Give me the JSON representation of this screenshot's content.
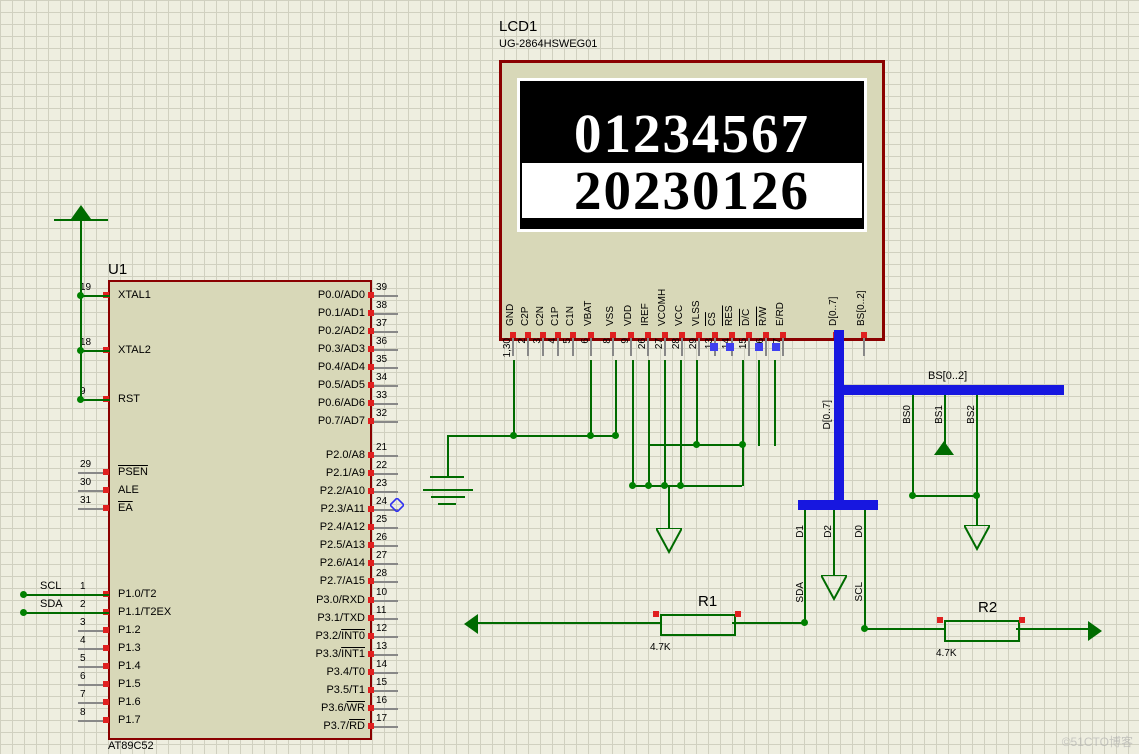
{
  "watermark": "©51CTO博客",
  "u1": {
    "name": "U1",
    "part": "AT89C52",
    "left_pins": [
      {
        "num": "19",
        "name": "XTAL1"
      },
      {
        "num": "18",
        "name": "XTAL2"
      },
      {
        "num": "9",
        "name": "RST"
      },
      {
        "num": "29",
        "name": "PSEN",
        "ov": true
      },
      {
        "num": "30",
        "name": "ALE"
      },
      {
        "num": "31",
        "name": "EA",
        "ov": true
      },
      {
        "num": "1",
        "name": "P1.0/T2"
      },
      {
        "num": "2",
        "name": "P1.1/T2EX"
      },
      {
        "num": "3",
        "name": "P1.2"
      },
      {
        "num": "4",
        "name": "P1.3"
      },
      {
        "num": "5",
        "name": "P1.4"
      },
      {
        "num": "6",
        "name": "P1.5"
      },
      {
        "num": "7",
        "name": "P1.6"
      },
      {
        "num": "8",
        "name": "P1.7"
      }
    ],
    "right_pins": [
      {
        "num": "39",
        "name": "P0.0/AD0"
      },
      {
        "num": "38",
        "name": "P0.1/AD1"
      },
      {
        "num": "37",
        "name": "P0.2/AD2"
      },
      {
        "num": "36",
        "name": "P0.3/AD3"
      },
      {
        "num": "35",
        "name": "P0.4/AD4"
      },
      {
        "num": "34",
        "name": "P0.5/AD5"
      },
      {
        "num": "33",
        "name": "P0.6/AD6"
      },
      {
        "num": "32",
        "name": "P0.7/AD7"
      },
      {
        "num": "21",
        "name": "P2.0/A8"
      },
      {
        "num": "22",
        "name": "P2.1/A9"
      },
      {
        "num": "23",
        "name": "P2.2/A10"
      },
      {
        "num": "24",
        "name": "P2.3/A11"
      },
      {
        "num": "25",
        "name": "P2.4/A12"
      },
      {
        "num": "26",
        "name": "P2.5/A13"
      },
      {
        "num": "27",
        "name": "P2.6/A14"
      },
      {
        "num": "28",
        "name": "P2.7/A15"
      },
      {
        "num": "10",
        "name": "P3.0/RXD"
      },
      {
        "num": "11",
        "name": "P3.1/TXD"
      },
      {
        "num": "12",
        "name": "P3.2/INT0",
        "ov_suf": "INT0",
        "pre": "P3.2/"
      },
      {
        "num": "13",
        "name": "P3.3/INT1",
        "ov_suf": "INT1",
        "pre": "P3.3/"
      },
      {
        "num": "14",
        "name": "P3.4/T0"
      },
      {
        "num": "15",
        "name": "P3.5/T1"
      },
      {
        "num": "16",
        "name": "P3.6/WR",
        "ov_suf": "WR",
        "pre": "P3.6/"
      },
      {
        "num": "17",
        "name": "P3.7/RD",
        "ov_suf": "RD",
        "pre": "P3.7/"
      }
    ]
  },
  "scl": "SCL",
  "sda": "SDA",
  "lcd1": {
    "name": "LCD1",
    "part": "UG-2864HSWEG01",
    "line1": "01234567",
    "line2": "20230126",
    "pins": [
      {
        "num": "1,30",
        "name": "GND"
      },
      {
        "num": "2",
        "name": "C2P"
      },
      {
        "num": "3",
        "name": "C2N"
      },
      {
        "num": "4",
        "name": "C1P"
      },
      {
        "num": "5",
        "name": "C1N"
      },
      {
        "num": "6",
        "name": "VBAT"
      },
      {
        "num": "8",
        "name": "VSS"
      },
      {
        "num": "9",
        "name": "VDD"
      },
      {
        "num": "26",
        "name": "IREF"
      },
      {
        "num": "27",
        "name": "VCOMH"
      },
      {
        "num": "28",
        "name": "VCC"
      },
      {
        "num": "29",
        "name": "VLSS"
      },
      {
        "num": "13",
        "name": "CS",
        "ov": true
      },
      {
        "num": "14",
        "name": "RES",
        "ov": true
      },
      {
        "num": "15",
        "name": "D/C",
        "ov": true
      },
      {
        "num": "16",
        "name": "R/W",
        "ov": true
      },
      {
        "num": "17",
        "name": "E/RD"
      },
      {
        "num": "",
        "name": "D[0..7]"
      },
      {
        "num": "",
        "name": "BS[0..2]"
      }
    ]
  },
  "bus_labels": {
    "d_range": "D[0..7]",
    "bs_range": "BS[0..2]",
    "d0": "D0",
    "d1": "D1",
    "d2": "D2",
    "bs0": "BS0",
    "bs1": "BS1",
    "bs2": "BS2",
    "sda": "SDA",
    "scl": "SCL"
  },
  "r1": {
    "name": "R1",
    "value": "4.7K"
  },
  "r2": {
    "name": "R2",
    "value": "4.7K"
  }
}
